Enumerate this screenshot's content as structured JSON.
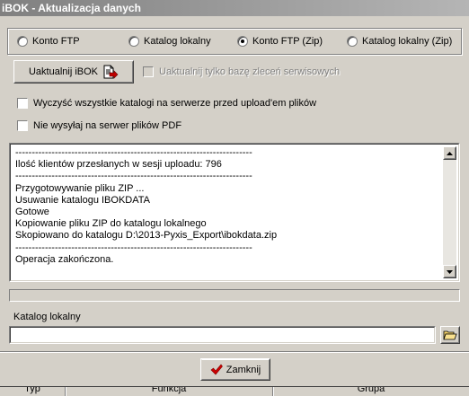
{
  "window": {
    "title": "iBOK - Aktualizacja danych"
  },
  "mode_options": [
    {
      "label": "Konto FTP",
      "checked": false
    },
    {
      "label": "Katalog lokalny",
      "checked": false
    },
    {
      "label": "Konto FTP (Zip)",
      "checked": true
    },
    {
      "label": "Katalog lokalny (Zip)",
      "checked": false
    }
  ],
  "actions": {
    "update_button_label": "Uaktualnij iBOK",
    "update_button_icon": "export-arrow-icon",
    "only_service_orders_label": "Uaktualnij tylko bazę zleceń serwisowych",
    "only_service_orders_checked": false,
    "only_service_orders_enabled": false
  },
  "options": {
    "clear_catalogs_label": "Wyczyść wszystkie katalogi na serwerze przed upload'em plików",
    "clear_catalogs_checked": false,
    "no_pdf_label": "Nie wysyłaj na serwer plików PDF",
    "no_pdf_checked": false
  },
  "log": {
    "text": "------------------------------------------------------------------------\nIlość klientów przesłanych w sesji uploadu: 796\n------------------------------------------------------------------------\nPrzygotowywanie pliku ZIP ...\nUsuwanie katalogu IBOKDATA\nGotowe\nKopiowanie pliku ZIP do katalogu lokalnego\nSkopiowano do katalogu D:\\2013-Pyxis_Export\\ibokdata.zip\n------------------------------------------------------------------------\nOperacja zakończona."
  },
  "progress": {
    "value": 0
  },
  "local_catalog": {
    "label": "Katalog lokalny",
    "value": "",
    "browse_icon": "folder-open-icon"
  },
  "footer": {
    "close_label": "Zamknij",
    "close_icon": "checkmark-icon"
  },
  "background_grid": {
    "columns": [
      "Typ",
      "Funkcja",
      "Grupa"
    ]
  },
  "colors": {
    "face": "#d4d0c8",
    "title_gradient_start": "#808080",
    "checkmark": "#d00000",
    "icon_arrow": "#c00000"
  }
}
